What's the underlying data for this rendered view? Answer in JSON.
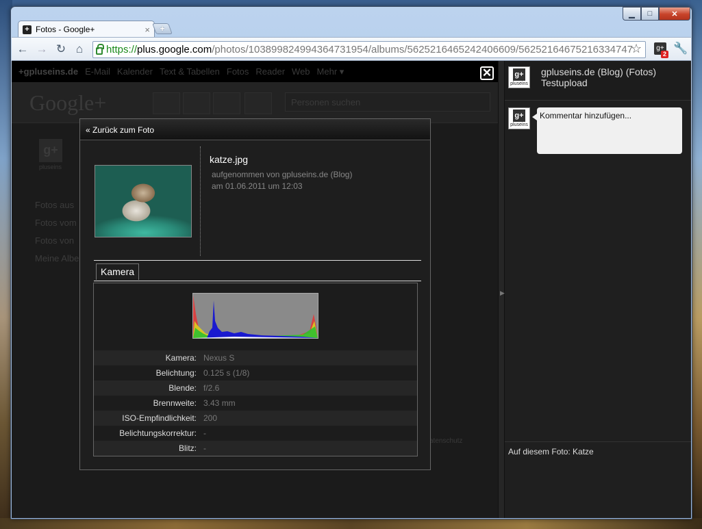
{
  "tab": {
    "title": "Fotos - Google+",
    "close": "×",
    "new_tab": "+"
  },
  "window": {
    "minimize": "▁",
    "maximize": "□",
    "close": "✕"
  },
  "toolbar": {
    "back": "←",
    "forward": "→",
    "reload": "↻",
    "home": "⌂",
    "url_scheme": "https://",
    "url_host": "plus.google.com",
    "url_path": "/photos/103899824994364731954/albums/5625216465242406609/56252164675216334747",
    "star": "☆",
    "ext_label": "g+",
    "ext_badge": "2",
    "wrench": "🔧"
  },
  "gbar": {
    "items": [
      "+gpluseins.de",
      "E-Mail",
      "Kalender",
      "Text & Tabellen",
      "Fotos",
      "Reader",
      "Web",
      "Mehr ▾"
    ]
  },
  "gheader": {
    "logo": "Google+",
    "search_placeholder": "Personen suchen"
  },
  "gsidebar": {
    "avatar": "g+",
    "avatar_label": "pluseins",
    "items": [
      "Fotos aus",
      "Fotos vom",
      "Fotos von",
      "Meine Alben"
    ],
    "footer": "atenschutz"
  },
  "modal": {
    "back_link": "« Zurück zum Foto",
    "file_name": "katze.jpg",
    "taken_by": "aufgenommen von gpluseins.de (Blog)",
    "date": "am 01.06.2011 um 12:03",
    "camera_tab": "Kamera",
    "exif": [
      {
        "label": "Kamera:",
        "value": "Nexus S"
      },
      {
        "label": "Belichtung:",
        "value": "0.125 s (1/8)"
      },
      {
        "label": "Blende:",
        "value": "f/2.6"
      },
      {
        "label": "Brennweite:",
        "value": "3.43 mm"
      },
      {
        "label": "ISO-Empfindlichkeit:",
        "value": "200"
      },
      {
        "label": "Belichtungskorrektur:",
        "value": "-"
      },
      {
        "label": "Blitz:",
        "value": "-"
      }
    ]
  },
  "right_panel": {
    "title": "gpluseins.de (Blog) (Fotos) Testupload",
    "avatar_g": "g+",
    "avatar_label": "pluseins",
    "comment_placeholder": "Kommentar hinzufügen...",
    "footer": "Auf diesem Foto: Katze"
  },
  "close_overlay": "✕"
}
